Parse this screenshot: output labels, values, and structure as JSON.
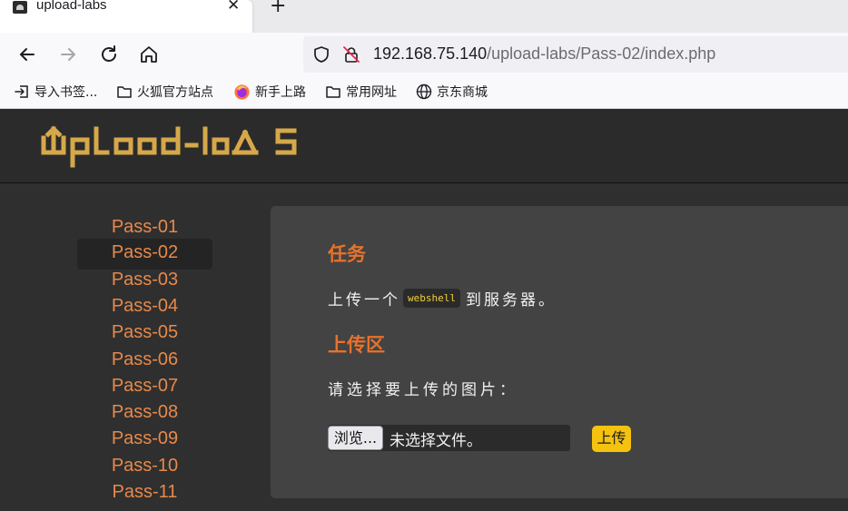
{
  "browser": {
    "tab_title": "upload-labs",
    "tab_close": "✕",
    "new_tab": "+",
    "url_host": "192.168.75.140",
    "url_path": "/upload-labs/Pass-02/index.php",
    "bookmarks": [
      {
        "label": "导入书签...",
        "icon": "import-icon"
      },
      {
        "label": "火狐官方站点",
        "icon": "folder-icon"
      },
      {
        "label": "新手上路",
        "icon": "firefox-icon"
      },
      {
        "label": "常用网址",
        "icon": "folder-icon"
      },
      {
        "label": "京东商城",
        "icon": "globe-icon"
      }
    ]
  },
  "site": {
    "logo_text": "upload-labs",
    "menu": [
      {
        "label": "Pass-01",
        "active": false
      },
      {
        "label": "Pass-02",
        "active": true
      },
      {
        "label": "Pass-03",
        "active": false
      },
      {
        "label": "Pass-04",
        "active": false
      },
      {
        "label": "Pass-05",
        "active": false
      },
      {
        "label": "Pass-06",
        "active": false
      },
      {
        "label": "Pass-07",
        "active": false
      },
      {
        "label": "Pass-08",
        "active": false
      },
      {
        "label": "Pass-09",
        "active": false
      },
      {
        "label": "Pass-10",
        "active": false
      },
      {
        "label": "Pass-11",
        "active": false
      }
    ]
  },
  "content": {
    "task_heading": "任务",
    "task_prefix": "上传一个",
    "task_code": "webshell",
    "task_suffix": "到服务器。",
    "upload_heading": "上传区",
    "select_label": "请选择要上传的图片：",
    "browse_label": "浏览...",
    "no_file_label": "未选择文件。",
    "submit_label": "上传"
  },
  "colors": {
    "accent_orange": "#e8722a",
    "menu_link": "#e8894a",
    "logo_gold": "#d6a84a",
    "submit_yellow": "#f5c20f",
    "code_yellow": "#f1d23a"
  }
}
